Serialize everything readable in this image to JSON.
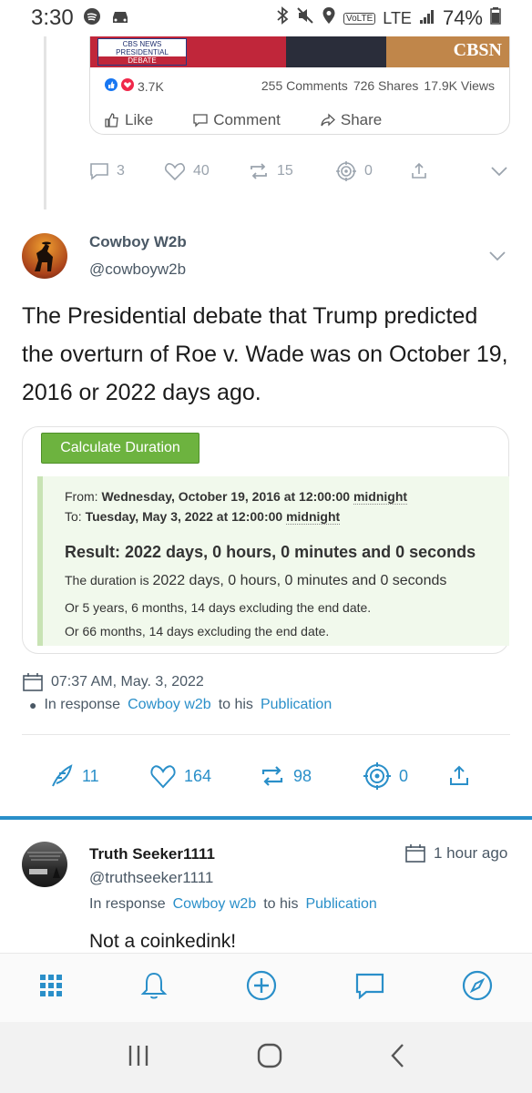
{
  "status_bar": {
    "time": "3:30",
    "battery": "74%",
    "network": "LTE"
  },
  "fb_embed": {
    "video_overlay": {
      "network_small": "CBS NEWS",
      "presidential": "PRESIDENTIAL",
      "debate": "DEBATE",
      "logo_text": "CBSN"
    },
    "reactions": "3.7K",
    "comments": "255 Comments",
    "shares": "726 Shares",
    "views": "17.9K Views",
    "like_label": "Like",
    "comment_label": "Comment",
    "share_label": "Share"
  },
  "prev_post_actions": {
    "replies": "3",
    "likes": "40",
    "reposts": "15",
    "tips": "0"
  },
  "post": {
    "author_name": "Cowboy W2b",
    "author_handle": "@cowboyw2b",
    "text": "The Presidential debate that Trump predicted the overturn of Roe v. Wade was on October 19, 2016 or 2022 days ago.",
    "timestamp": "07:37 AM, May. 3, 2022",
    "response_prefix": "In response",
    "response_user": "Cowboy w2b",
    "response_mid": "to his",
    "response_link": "Publication",
    "actions": {
      "replies": "11",
      "likes": "164",
      "reposts": "98",
      "tips": "0"
    }
  },
  "calculator": {
    "button": "Calculate Duration",
    "from_prefix": "From:",
    "from_value": "Wednesday, October 19, 2016 at 12:00:00",
    "from_suffix": "midnight",
    "to_prefix": "To:",
    "to_value": "Tuesday, May 3, 2022 at 12:00:00",
    "to_suffix": "midnight",
    "result": "Result: 2022 days, 0 hours, 0 minutes and 0 seconds",
    "duration_prefix": "The duration is",
    "duration_value": "2022 days, 0 hours, 0 minutes and 0 seconds",
    "alt1": "Or 5 years, 6 months, 14 days excluding the end date.",
    "alt2": "Or 66 months, 14 days excluding the end date."
  },
  "reply": {
    "author_name": "Truth Seeker1111",
    "author_handle": "@truthseeker1111",
    "time": "1 hour ago",
    "response_prefix": "In response",
    "response_user": "Cowboy w2b",
    "response_mid": "to his",
    "response_link": "Publication",
    "text": "Not a coinkedink!"
  },
  "colors": {
    "accent": "#2a8fc9",
    "calc_green": "#6db33f",
    "calc_bg": "#f1f9ec"
  },
  "icons": {
    "bottom_nav": [
      "grid-icon",
      "bell-icon",
      "plus-circle-icon",
      "chat-icon",
      "compass-icon"
    ],
    "system_nav": [
      "recents-icon",
      "home-icon",
      "back-icon"
    ]
  }
}
